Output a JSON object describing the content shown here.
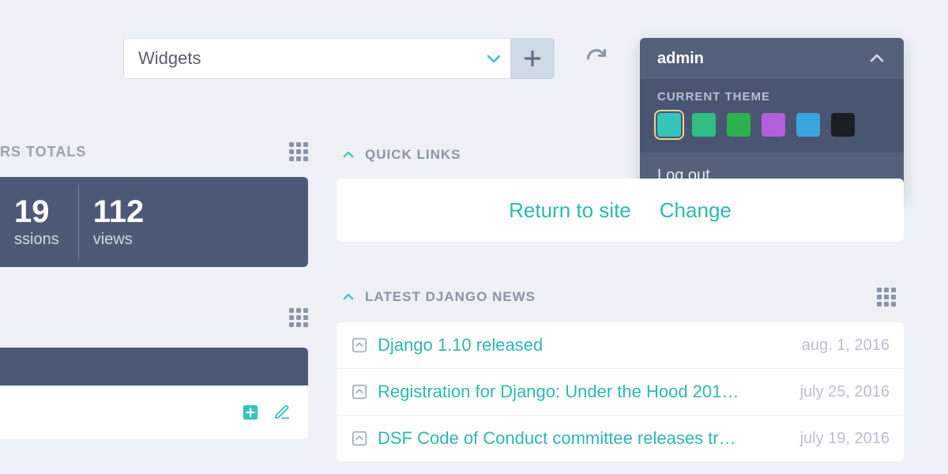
{
  "toolbar": {
    "widgets_label": "Widgets"
  },
  "user_menu": {
    "username": "admin",
    "theme_section_title": "CURRENT THEME",
    "logout_label": "Log out",
    "swatches": [
      "#34c4b9",
      "#2fbf82",
      "#2bb34f",
      "#b45ed9",
      "#3aa6e0",
      "#1b1f23"
    ],
    "selected_swatch_index": 0
  },
  "totals": {
    "header_label": "RS TOTALS",
    "stats": [
      {
        "value": "19",
        "label": "ssions"
      },
      {
        "value": "112",
        "label": "views"
      }
    ]
  },
  "quick_links": {
    "header": "QUICK LINKS",
    "items": [
      "Return to site",
      "Change"
    ]
  },
  "news": {
    "header": "LATEST DJANGO NEWS",
    "items": [
      {
        "title": "Django 1.10 released",
        "date": "aug. 1, 2016"
      },
      {
        "title": "Registration for Django: Under the Hood 201…",
        "date": "july 25, 2016"
      },
      {
        "title": "DSF Code of Conduct committee releases tr…",
        "date": "july 19, 2016"
      }
    ]
  }
}
